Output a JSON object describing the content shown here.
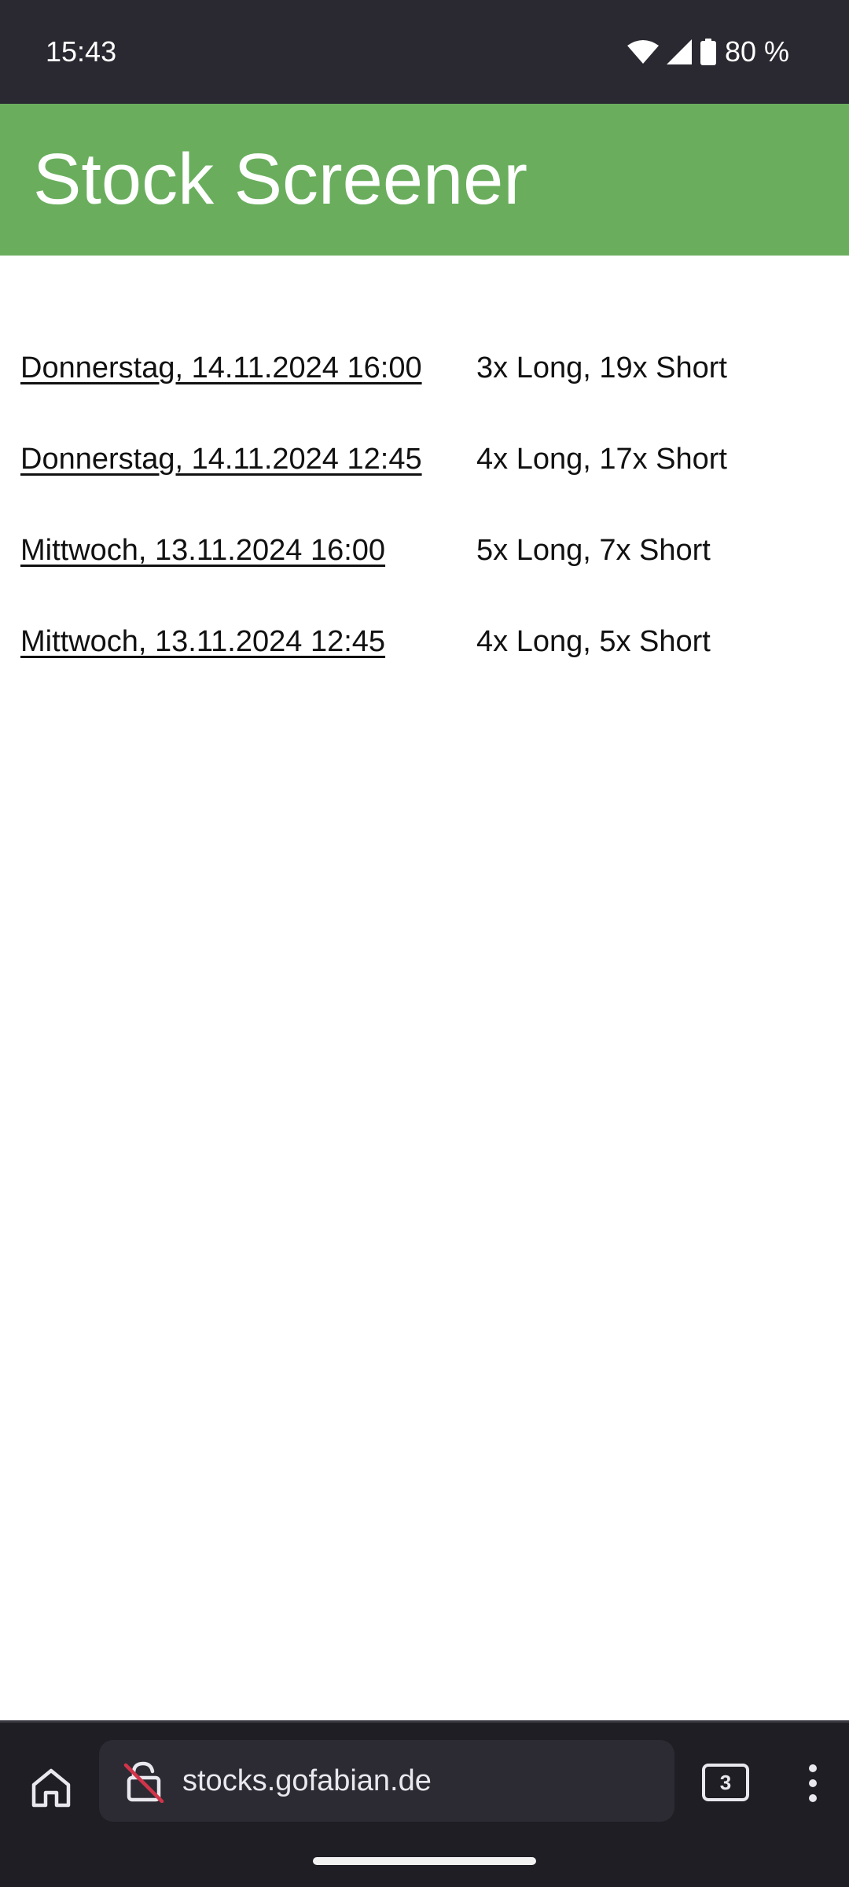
{
  "status_bar": {
    "time": "15:43",
    "battery_text": "80 %",
    "icons": [
      "wifi-icon",
      "signal-icon",
      "battery-icon"
    ]
  },
  "header": {
    "title": "Stock Screener",
    "background_color": "#6aae5d"
  },
  "entries": [
    {
      "date_link": "Donnerstag, 14.11.2024 16:00",
      "summary": "3x Long, 19x Short"
    },
    {
      "date_link": "Donnerstag, 14.11.2024 12:45",
      "summary": "4x Long, 17x Short"
    },
    {
      "date_link": "Mittwoch, 13.11.2024 16:00",
      "summary": "5x Long, 7x Short"
    },
    {
      "date_link": "Mittwoch, 13.11.2024 12:45",
      "summary": "4x Long, 5x Short"
    }
  ],
  "browser_bar": {
    "url": "stocks.gofabian.de",
    "tab_count": "3",
    "icons": [
      "home-icon",
      "not-secure-lock-icon",
      "tabs-icon",
      "more-vert-icon"
    ]
  }
}
